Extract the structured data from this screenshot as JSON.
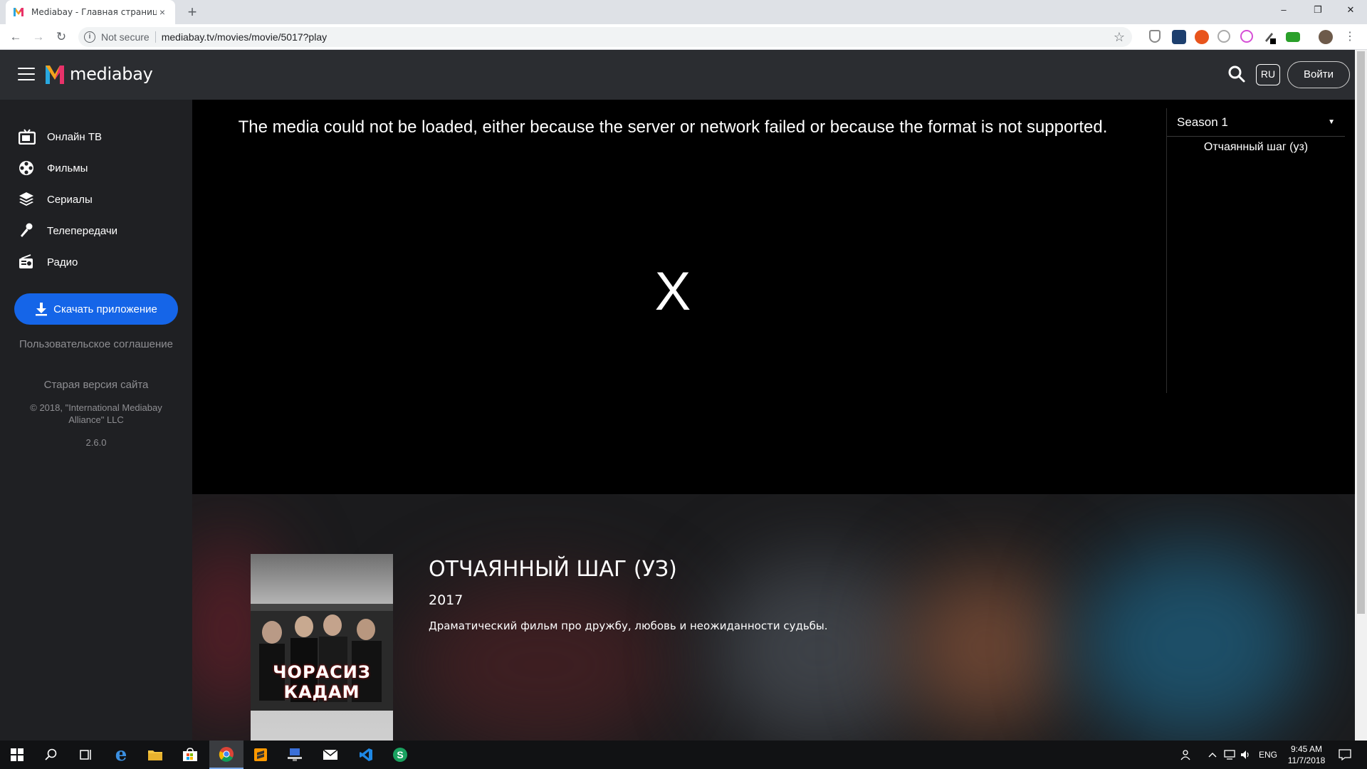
{
  "browser": {
    "tab_title": "Mediabay - Главная страница",
    "tab_close": "×",
    "new_tab": "+",
    "window_controls": {
      "minimize": "–",
      "restore": "❐",
      "close": "✕"
    },
    "nav": {
      "back": "←",
      "forward": "→",
      "reload": "↻"
    },
    "info_icon": "i",
    "not_secure": "Not secure",
    "url": "mediabay.tv/movies/movie/5017?play",
    "bookmark_star": "☆",
    "extensions": [
      "shield-extension",
      "qr-extension",
      "cookie-extension",
      "circle-extension",
      "flower-extension",
      "brush-extension",
      "green-extension",
      "profile-avatar",
      "menu-dots"
    ]
  },
  "header": {
    "logo_text": "mediabay",
    "lang": "RU",
    "login": "Войти"
  },
  "sidebar": {
    "items": [
      {
        "label": "Онлайн ТВ",
        "icon": "tv-icon"
      },
      {
        "label": "Фильмы",
        "icon": "film-reel-icon"
      },
      {
        "label": "Сериалы",
        "icon": "layers-icon"
      },
      {
        "label": "Телепередачи",
        "icon": "microphone-icon"
      },
      {
        "label": "Радио",
        "icon": "radio-icon"
      }
    ],
    "download_app": "Скачать приложение",
    "user_agreement": "Пользовательское соглашение",
    "old_version": "Старая версия сайта",
    "copyright": "© 2018, \"International Mediabay Alliance\" LLC",
    "version": "2.6.0"
  },
  "player": {
    "error_message": "The media could not be loaded, either because the server or network failed or because the format is not supported.",
    "error_icon": "X",
    "season_select": "Season 1",
    "episodes": [
      "Отчаянный шаг (уз)"
    ]
  },
  "film": {
    "title": "ОТЧАЯННЫЙ ШАГ (УЗ)",
    "year": "2017",
    "description": "Драматический фильм про дружбу, любовь и неожиданности судьбы.",
    "poster_text": "ЧОРАСИЗ КАДАМ"
  },
  "taskbar": {
    "apps": [
      "start-icon",
      "search-icon",
      "task-view-icon",
      "edge-icon",
      "file-explorer-icon",
      "store-icon",
      "chrome-icon",
      "sublime-icon",
      "network-app-icon",
      "mail-icon",
      "vscode-icon",
      "s-app-icon"
    ],
    "lang": "ENG",
    "time": "9:45 AM",
    "date": "11/7/2018"
  },
  "colors": {
    "header_bg": "#2b2d31",
    "sidebar_bg": "#1f2023",
    "accent_blue": "#1565e8"
  }
}
